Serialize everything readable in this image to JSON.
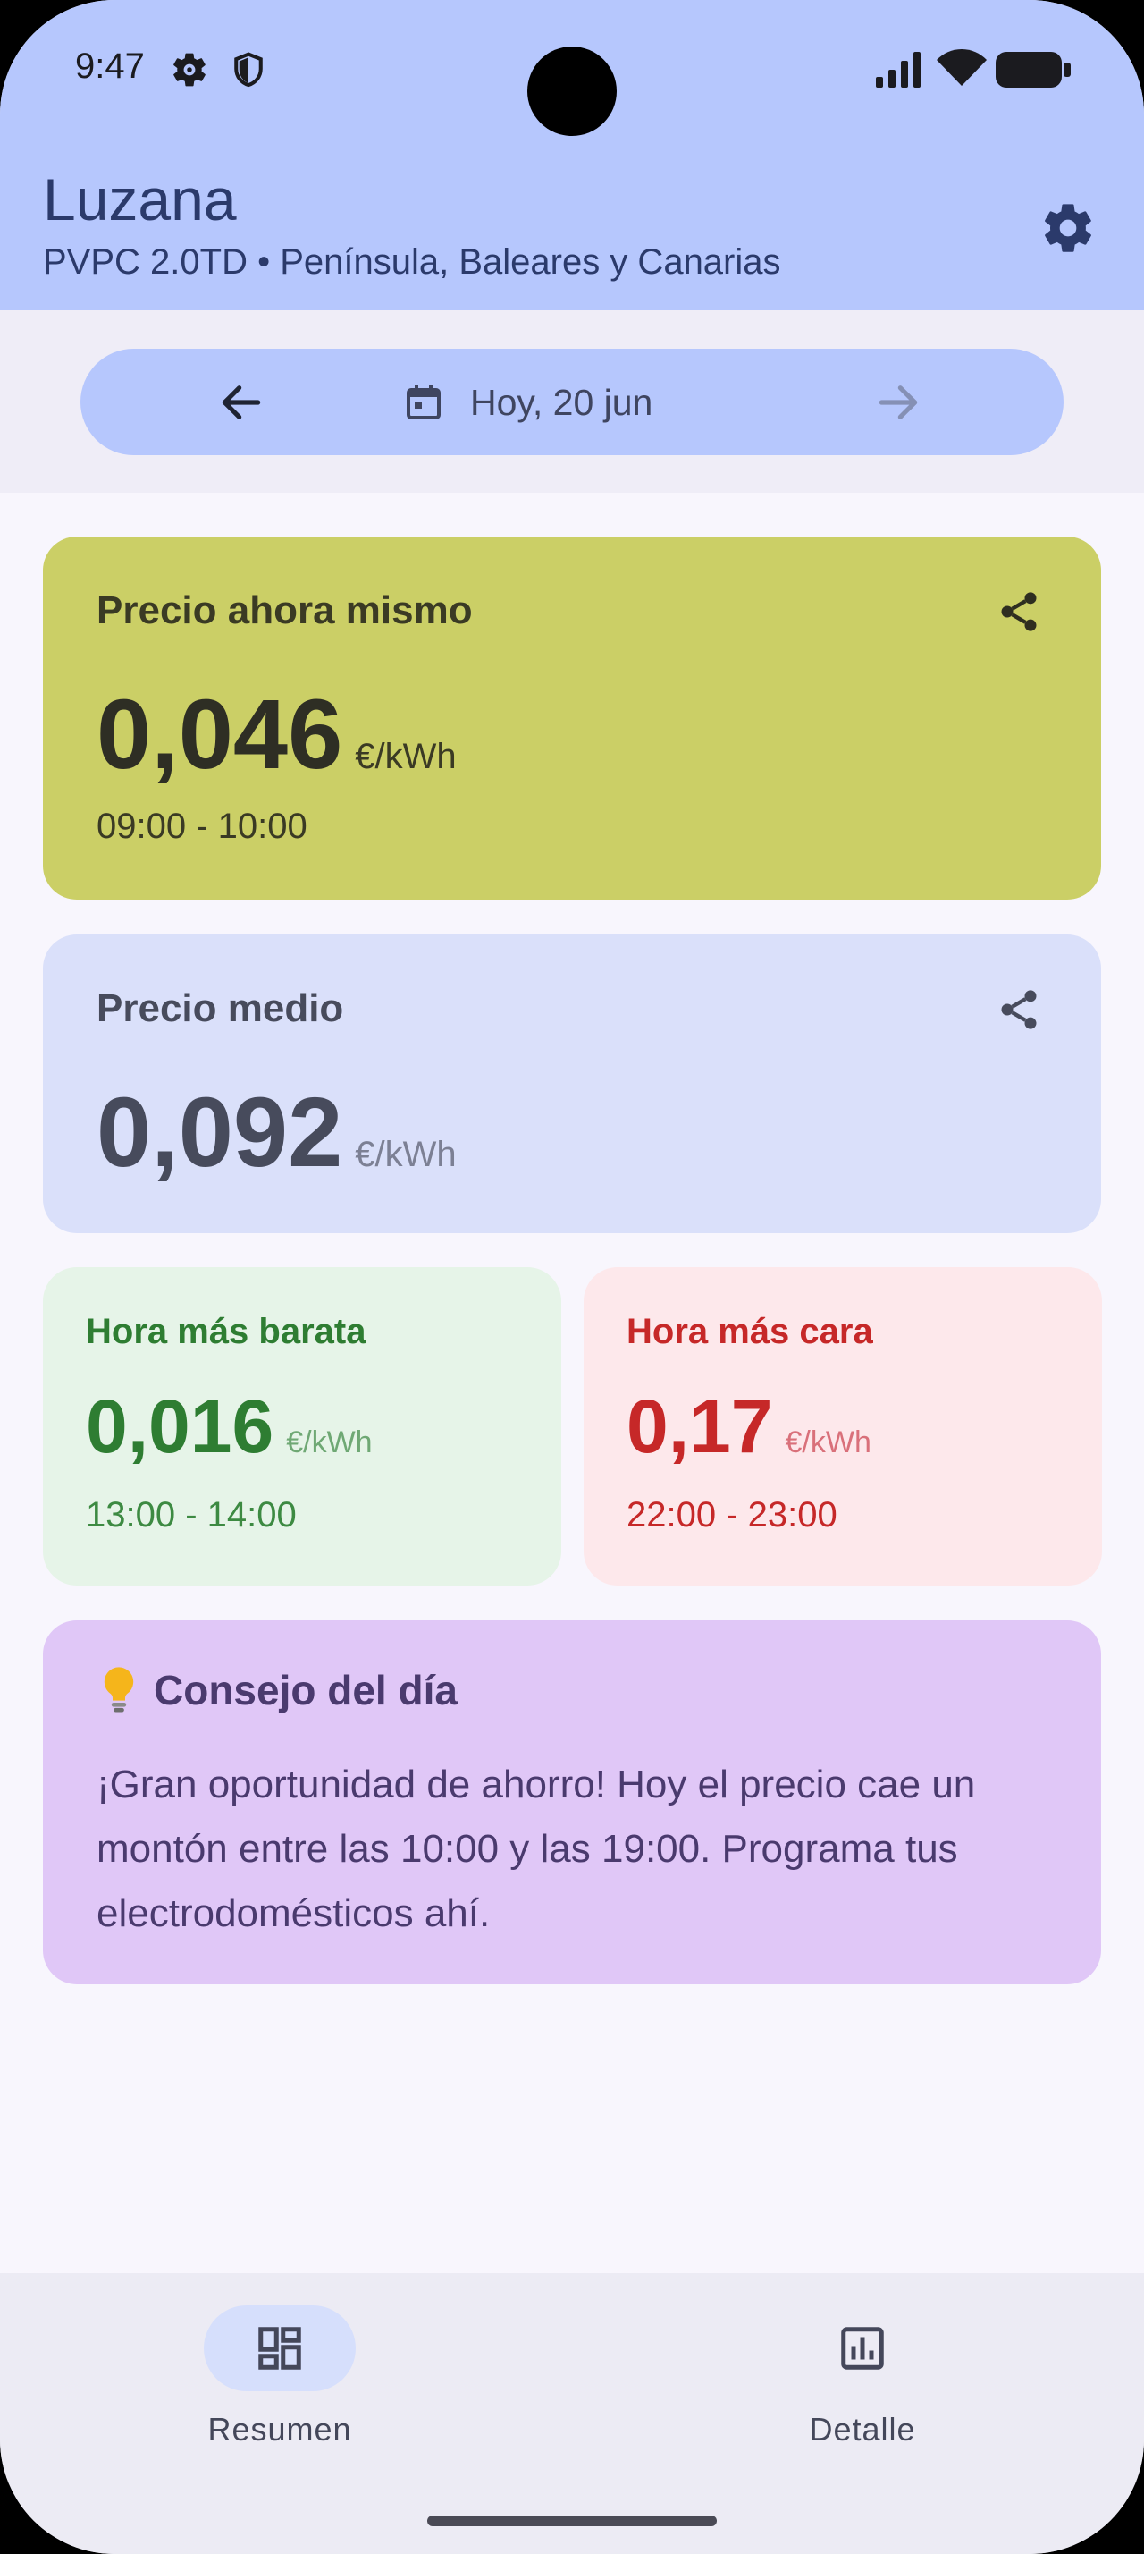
{
  "status_bar": {
    "time": "9:47",
    "left_icons": [
      "gear-icon",
      "shield-icon"
    ],
    "right_icons": [
      "signal-icon",
      "wifi-icon",
      "battery-icon"
    ]
  },
  "header": {
    "title": "Luzana",
    "subtitle": "PVPC 2.0TD • Península, Baleares y Canarias",
    "settings_icon": "gear-icon"
  },
  "date_nav": {
    "prev_icon": "arrow-left-icon",
    "calendar_icon": "calendar-icon",
    "label": "Hoy, 20 jun",
    "next_icon": "arrow-right-icon",
    "next_enabled": false
  },
  "cards": {
    "now": {
      "title": "Precio ahora mismo",
      "value": "0,046",
      "unit": "€/kWh",
      "range": "09:00 - 10:00",
      "color": "#cbcf66"
    },
    "average": {
      "title": "Precio medio",
      "value": "0,092",
      "unit": "€/kWh",
      "color": "#dae0fa"
    },
    "cheapest": {
      "title": "Hora más barata",
      "value": "0,016",
      "unit": "€/kWh",
      "range": "13:00 - 14:00",
      "color": "#2e7d32"
    },
    "most_expensive": {
      "title": "Hora más cara",
      "value": "0,17",
      "unit": "€/kWh",
      "range": "22:00 - 23:00",
      "color": "#c62828"
    },
    "tip": {
      "icon": "lightbulb-icon",
      "title": "Consejo del día",
      "text": "¡Gran oportunidad de ahorro! Hoy el precio cae un montón entre las 10:00 y las 19:00. Programa tus electrodomésticos ahí."
    }
  },
  "bottom_nav": {
    "items": [
      {
        "label": "Resumen",
        "icon": "dashboard-icon",
        "selected": true
      },
      {
        "label": "Detalle",
        "icon": "bar-chart-icon",
        "selected": false
      }
    ]
  }
}
